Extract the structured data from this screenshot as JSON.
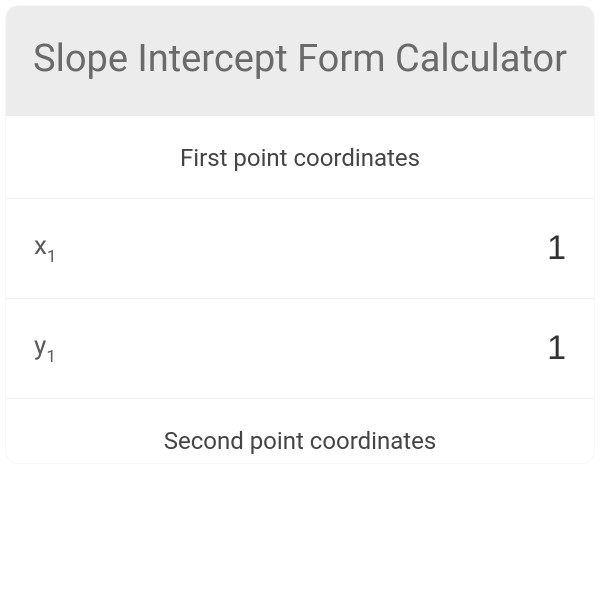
{
  "header": {
    "title": "Slope Intercept Form Calculator"
  },
  "sections": {
    "first": {
      "label": "First point coordinates",
      "x": {
        "label_base": "x",
        "label_sub": "1",
        "value": "1"
      },
      "y": {
        "label_base": "y",
        "label_sub": "1",
        "value": "1"
      }
    },
    "second": {
      "label": "Second point coordinates"
    }
  }
}
